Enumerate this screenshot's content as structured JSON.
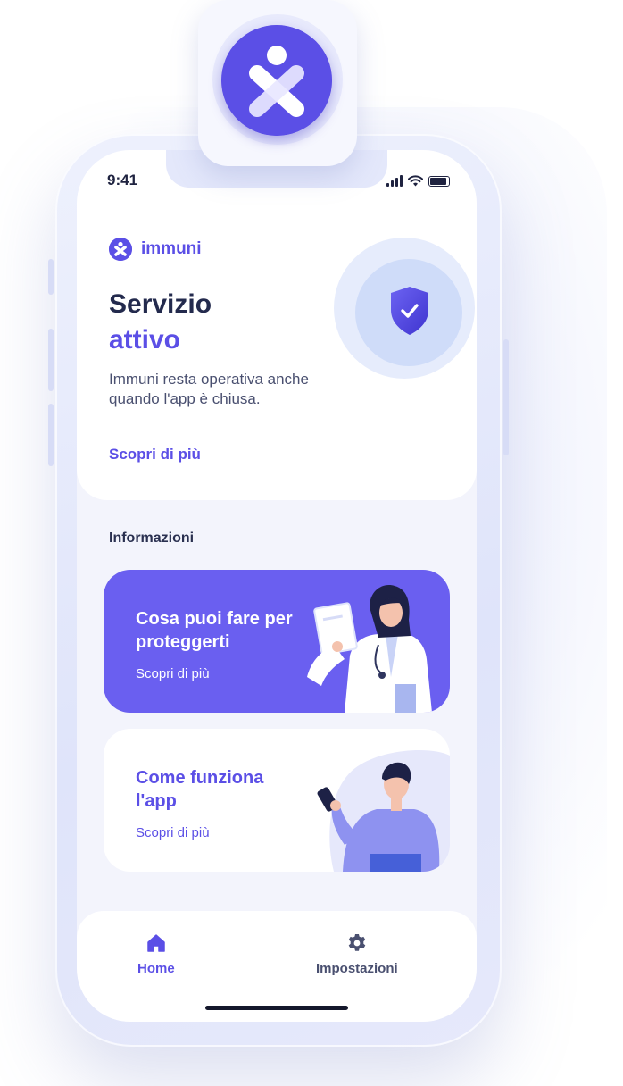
{
  "status_bar": {
    "time": "9:41"
  },
  "header": {
    "brand": "immuni",
    "title_line1": "Servizio",
    "title_line2": "attivo",
    "description": "Immuni resta operativa anche quando l'app è chiusa.",
    "link": "Scopri di più"
  },
  "section": {
    "title": "Informazioni"
  },
  "cards": [
    {
      "title": "Cosa puoi fare per proteggerti",
      "link": "Scopri di più"
    },
    {
      "title": "Come funziona l'app",
      "link": "Scopri di più"
    }
  ],
  "tabbar": {
    "home_label": "Home",
    "settings_label": "Impostazioni"
  },
  "colors": {
    "accent": "#5b4fe6",
    "card_primary": "#6a5ff0",
    "text_dark": "#232a4d"
  },
  "icons": [
    "immuni-logo-icon",
    "shield-check-icon",
    "home-icon",
    "gear-icon",
    "signal-icon",
    "wifi-icon",
    "battery-icon"
  ]
}
